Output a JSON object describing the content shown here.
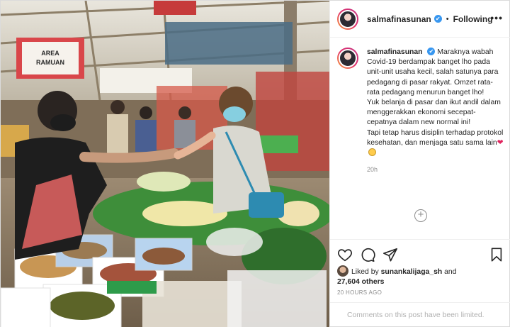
{
  "post": {
    "username": "salmafinasunan",
    "verified_mark": "✔",
    "separator": "•",
    "follow_label": "Following",
    "more_label": "•••",
    "caption": {
      "username": "salmafinasunan",
      "line1": "Maraknya wabah Covid-19 berdampak banget lho pada unit-unit usaha kecil, salah satunya para pedagang di pasar rakyat. Omzet rata-rata pedagang menurun banget lho!",
      "line2": "Yuk belanja di pasar dan ikut andil dalam menggerakkan ekonomi secepat-cepatnya dalam new normal ini!",
      "line3": "Tapi tetap harus disiplin terhadap protokol kesehatan, dan menjaga satu sama lain",
      "heart": "❤",
      "time": "20h"
    },
    "load_more_label": "+",
    "actions": {
      "like": "heart-outline",
      "comment": "comment-outline",
      "share": "paper-plane-outline",
      "save": "bookmark-outline"
    },
    "likes": {
      "prefix": "Liked by",
      "user": "sunankalijaga_sh",
      "conj": "and",
      "others": "27,604 others"
    },
    "timestamp": "20 HOURS AGO",
    "comments_notice": "Comments on this post have been limited.",
    "photo_sign": {
      "line1": "AREA",
      "line2": "RAMUAN"
    }
  },
  "colors": {
    "verified": "#3897f0",
    "muted": "#8e8e8e",
    "border": "#efefef",
    "heart": "#e0245e"
  }
}
